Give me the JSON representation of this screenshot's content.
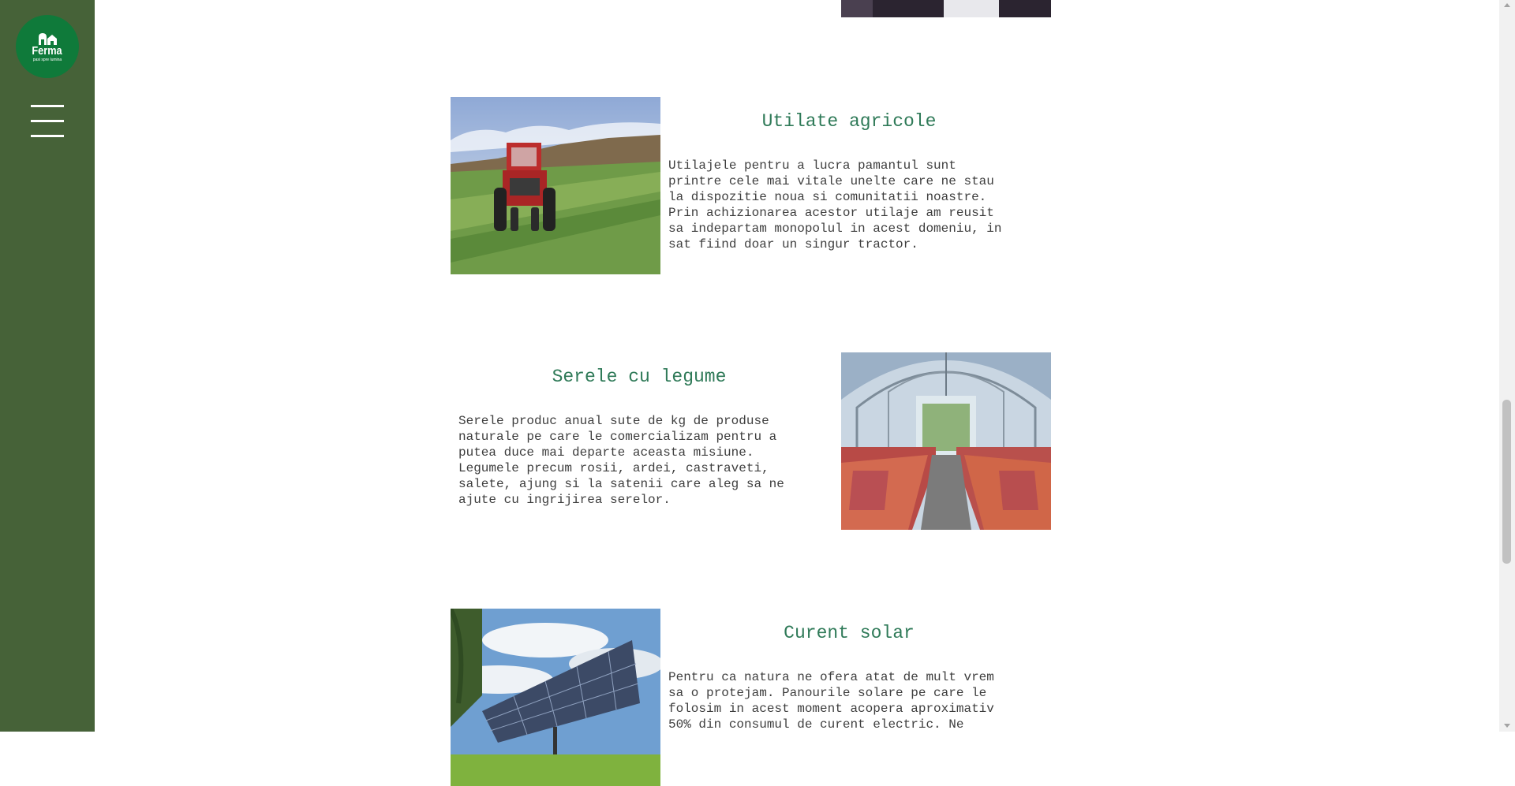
{
  "brand": {
    "name": "Ferma",
    "tagline": "pasi spre lumina",
    "color": "#0f7a3a"
  },
  "sidebar": {
    "color": "#466238",
    "menu_icon": "hamburger-menu-icon"
  },
  "sections": [
    {
      "title": "Utilate agricole",
      "text": "Utilajele pentru a lucra pamantul sunt\nprintre cele mai vitale unelte care ne stau\nla dispozitie noua si comunitatii noastre.\nPrin achizionarea acestor utilaje am reusit\nsa indepartam monopolul in acest domeniu, in\nsat fiind doar un singur tractor.",
      "image": "red-tractor-in-field"
    },
    {
      "title": "Serele cu legume",
      "text": "Serele produc anual sute de kg de produse\nnaturale pe care le comercializam pentru a\nputea duce mai departe aceasta misiune.\nLegumele precum rosii, ardei, castraveti,\nsalete, ajung si la satenii care aleg sa ne\najute cu ingrijirea serelor.",
      "image": "greenhouse-with-plants"
    },
    {
      "title": "Curent solar",
      "text": "Pentru ca natura ne ofera atat de mult vrem\nsa o protejam. Panourile solare pe care le\nfolosim in acest moment acopera aproximativ\n50% din consumul de curent electric. Ne",
      "image": "solar-panels-field"
    }
  ],
  "colors": {
    "title": "#2f7a58",
    "text": "#3e3e3e"
  }
}
